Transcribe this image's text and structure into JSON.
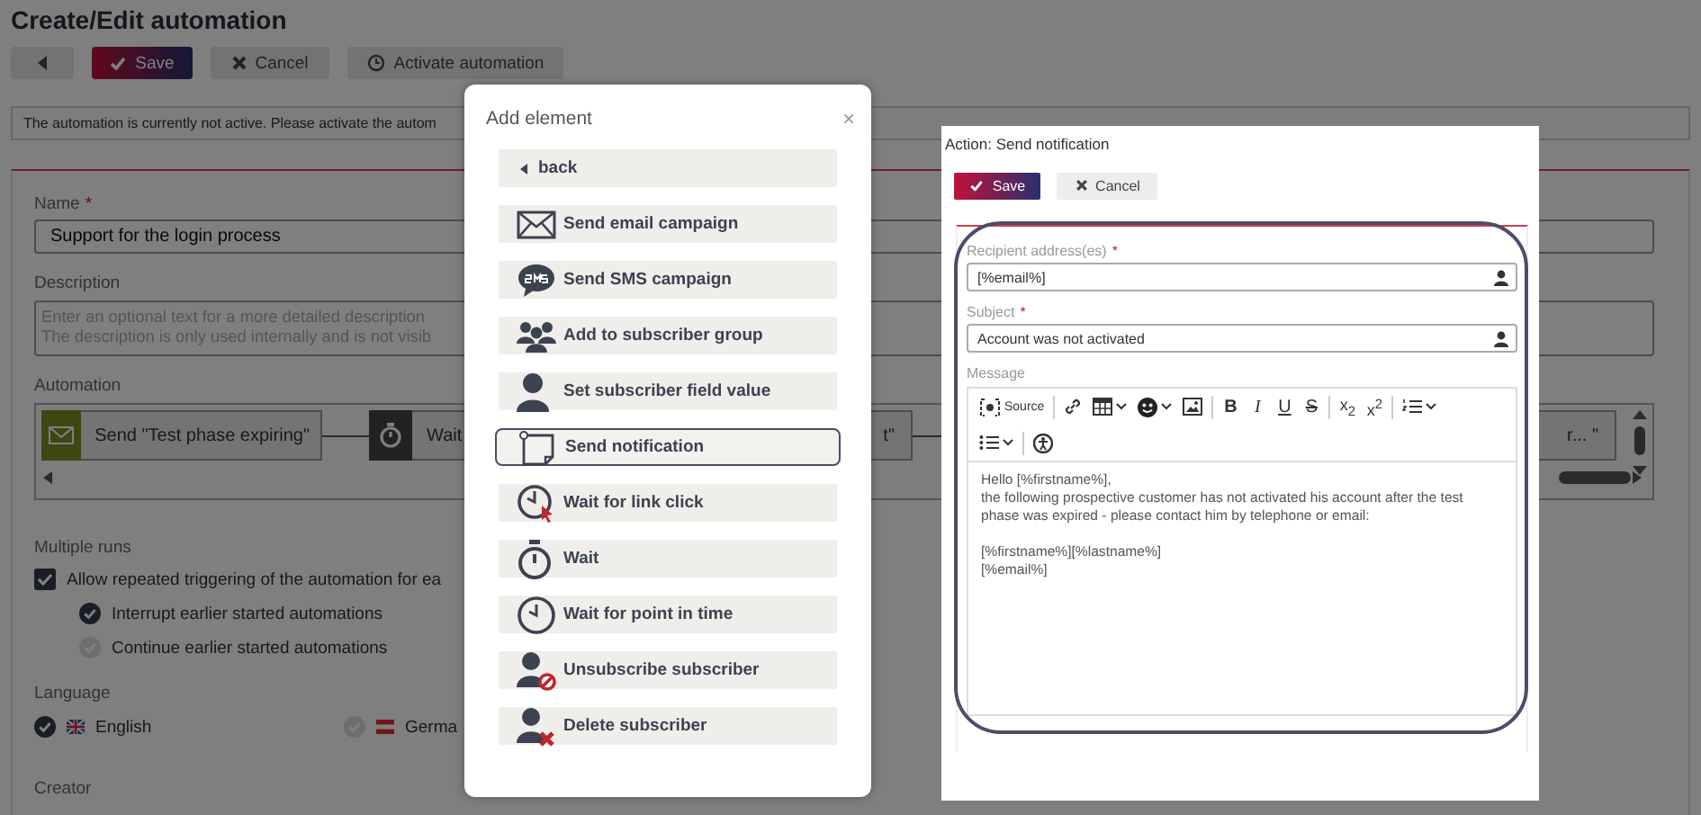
{
  "page": {
    "title": "Create/Edit automation",
    "toolbar": [
      {
        "kind": "back"
      },
      {
        "kind": "save",
        "label": "Save"
      },
      {
        "kind": "cancel",
        "label": "Cancel"
      },
      {
        "kind": "activate",
        "label": "Activate automation"
      }
    ],
    "notice": "The automation is currently not active. Please activate the autom",
    "name": {
      "label": "Name",
      "required_mark": "*",
      "value": "Support for the login process"
    },
    "description": {
      "label": "Description",
      "placeholder": "Enter an optional text for a more detailed description\nThe description is only used internally and is not visib"
    },
    "automation": {
      "label": "Automation",
      "steps": [
        {
          "kind": "email",
          "label": "Send \"Test phase expiring\""
        },
        {
          "kind": "wait",
          "label": "Wait"
        },
        {
          "label": "t\""
        },
        {
          "label": "r... \""
        }
      ]
    },
    "multiple_runs": {
      "label": "Multiple runs",
      "checkbox": {
        "label": "Allow repeated triggering of the automation for ea",
        "checked": true
      },
      "options": [
        {
          "label": "Interrupt earlier started automations",
          "selected": true
        },
        {
          "label": "Continue earlier started automations",
          "selected": false
        }
      ]
    },
    "language": {
      "label": "Language",
      "options": [
        {
          "kind": "uk",
          "label": "English",
          "selected": true
        },
        {
          "kind": "de",
          "label": "Germa",
          "selected": false
        }
      ]
    },
    "creator": {
      "label": "Creator"
    }
  },
  "dialog": {
    "title": "Add element",
    "close": "×",
    "items": [
      {
        "kind": "back",
        "label": "back",
        "selected": false
      },
      {
        "kind": "email",
        "label": "Send email campaign",
        "selected": false
      },
      {
        "kind": "sms",
        "label": "Send SMS campaign",
        "selected": false
      },
      {
        "kind": "group",
        "label": "Add to subscriber group",
        "selected": false
      },
      {
        "kind": "person",
        "label": "Set subscriber field value",
        "selected": false
      },
      {
        "kind": "notification",
        "label": "Send notification",
        "selected": true
      },
      {
        "kind": "linkclick",
        "label": "Wait for link click",
        "selected": false
      },
      {
        "kind": "stopwatch",
        "label": "Wait",
        "selected": false
      },
      {
        "kind": "clock",
        "label": "Wait for point in time",
        "selected": false
      },
      {
        "kind": "unsubscribe",
        "label": "Unsubscribe subscriber",
        "selected": false
      },
      {
        "kind": "delete",
        "label": "Delete subscriber",
        "selected": false
      }
    ]
  },
  "action": {
    "title": "Action: Send notification",
    "buttons": [
      {
        "kind": "save",
        "label": "Save"
      },
      {
        "kind": "cancel",
        "label": "Cancel"
      }
    ],
    "form": {
      "highlighted": true,
      "recipient": {
        "label": "Recipient address(es)",
        "required_mark": "*",
        "value": "[%email%]"
      },
      "subject": {
        "label": "Subject",
        "required_mark": "*",
        "value": "Account was not activated"
      },
      "message": {
        "label": "Message",
        "toolbar": [
          {
            "groups": [
              [
                {
                  "kind": "source",
                  "label": "Source"
                }
              ],
              [
                {
                  "kind": "link"
                },
                {
                  "kind": "table",
                  "dropdown": true
                },
                {
                  "kind": "emoji",
                  "dropdown": true
                },
                {
                  "kind": "image"
                }
              ],
              [
                {
                  "kind": "bold",
                  "label": "B"
                },
                {
                  "kind": "italic",
                  "label": "I"
                },
                {
                  "kind": "underline",
                  "label": "U"
                },
                {
                  "kind": "strike",
                  "label": "S"
                }
              ],
              [
                {
                  "kind": "subscript",
                  "label": "x$_{2}$"
                },
                {
                  "kind": "superscript",
                  "label": "x$^{2}$"
                }
              ],
              [
                {
                  "kind": "numlist",
                  "dropdown": true
                }
              ]
            ]
          },
          {
            "groups": [
              [
                {
                  "kind": "bullist",
                  "dropdown": true
                }
              ],
              [
                {
                  "kind": "accessibility"
                }
              ]
            ]
          }
        ],
        "paragraphs": [
          "Hello [%firstname%],\nthe following prospective customer has not activated his account after the test phase was expired - please contact him by telephone or email:",
          "[%firstname%][%lastname%]\n[%email%]"
        ]
      }
    }
  }
}
